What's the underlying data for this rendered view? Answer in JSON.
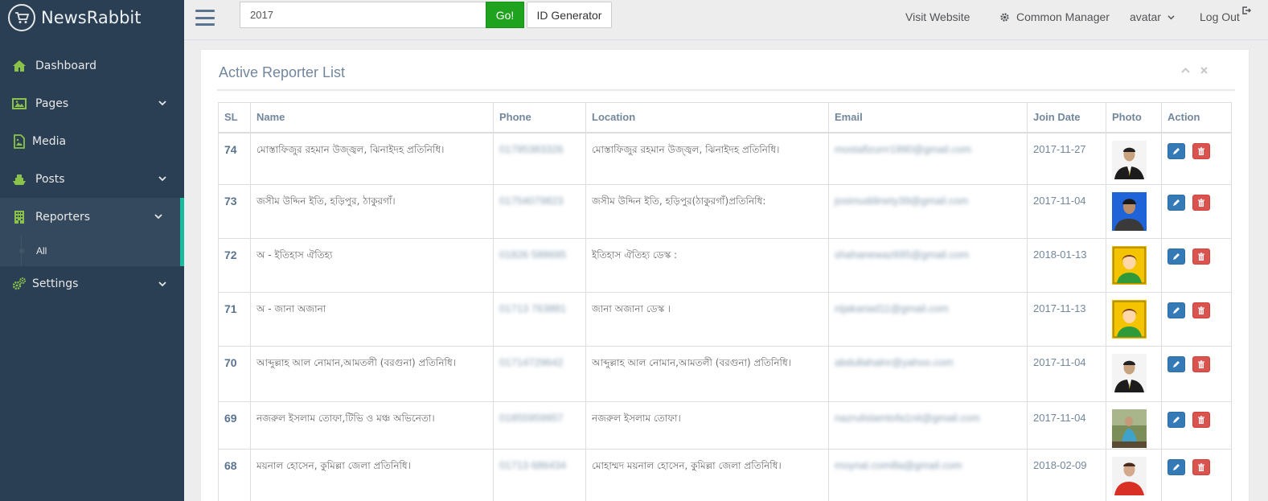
{
  "app": {
    "name": "NewsRabbit"
  },
  "sidebar": {
    "items": [
      {
        "label": "Dashboard",
        "icon": "home-icon"
      },
      {
        "label": "Pages",
        "icon": "image-icon"
      },
      {
        "label": "Media",
        "icon": "file-image-icon"
      },
      {
        "label": "Posts",
        "icon": "ship-icon"
      },
      {
        "label": "Reporters",
        "icon": "building-icon"
      },
      {
        "label": "Settings",
        "icon": "cogs-icon"
      }
    ],
    "subitem": {
      "label": "All"
    }
  },
  "topnav": {
    "search_value": "2017",
    "go_label": "Go!",
    "id_generator_label": "ID Generator",
    "visit_label": "Visit Website",
    "common_label": "Common Manager",
    "avatar_label": "avatar",
    "logout_label": "Log Out"
  },
  "panel": {
    "title": "Active Reporter List"
  },
  "table": {
    "headers": [
      "SL",
      "Name",
      "Phone",
      "Location",
      "Email",
      "Join Date",
      "Photo",
      "Action"
    ],
    "rows": [
      {
        "sl": "74",
        "name": "মোস্তাফিজুর রহমান উজ্জ্বল, ঝিনাইদহ প্রতিনিধি।",
        "phone": "01795383326",
        "location": "মোস্তাফিজুর রহমান উজ্জ্বল, ঝিনাইদহ প্রতিনিধি।",
        "email": "mostafizurrr1990@gmail.com",
        "date": "2017-11-27",
        "photo": "suit-avatar"
      },
      {
        "sl": "73",
        "name": "জসীম উদ্দিন ইতি, হড়িপুর, ঠাকুরগাঁ।",
        "phone": "01754079823",
        "location": "জসীম উদ্দিন ইতি, হড়িপুর(ঠাকুরগাঁ)প্রতিনিধি:",
        "email": "josimuddinety39@gmail.com",
        "date": "2017-11-04",
        "photo": "blue-avatar"
      },
      {
        "sl": "72",
        "name": "অ - ইতিহাস ঐতিহ্য",
        "phone": "01826 588695",
        "location": "ইতিহাস ঐতিহ্য ডেস্ক :",
        "email": "shahanewaz695@gmail.com",
        "date": "2018-01-13",
        "photo": "default-avatar"
      },
      {
        "sl": "71",
        "name": "অ - জানা অজানা",
        "phone": "01713 763881",
        "location": "জানা অজানা ডেস্ক ।",
        "email": "nijakariad11@gmail.com",
        "date": "2017-11-13",
        "photo": "default-avatar"
      },
      {
        "sl": "70",
        "name": "আব্দুল্লাহ আল নোমান,আমতলী (বরগুনা) প্রতিনিধি।",
        "phone": "01714729642",
        "location": "আব্দুল্লাহ আল নোমান,আমতলী (বরগুনা) প্রতিনিধি।",
        "email": "abdullahalnr@yahoo.com",
        "date": "2017-11-04",
        "photo": "suit-avatar"
      },
      {
        "sl": "69",
        "name": "নজরুল ইসলাম তোফা,টিভি ও মঞ্চ অভিনেতা।",
        "phone": "01855959957",
        "location": "নজরুল ইসলাম তোফা।",
        "email": "nazrulislamtofa1nit@gmail.com",
        "date": "2017-11-04",
        "photo": "outdoor-avatar"
      },
      {
        "sl": "68",
        "name": "ময়নাল হোসেন, কুমিল্লা জেলা প্রতিনিধি।",
        "phone": "01713 686434",
        "location": "মোহাম্মদ ময়নাল হোসেন, কুমিল্লা জেলা প্রতিনিধি।",
        "email": "moynal.comilla@gmail.com",
        "date": "2018-02-09",
        "photo": "red-avatar"
      }
    ]
  },
  "colors": {
    "sidebar": "#2a3f54",
    "accent": "#1abb9c",
    "go": "#1fa31f",
    "edit": "#337ab7",
    "delete": "#d9534f"
  }
}
